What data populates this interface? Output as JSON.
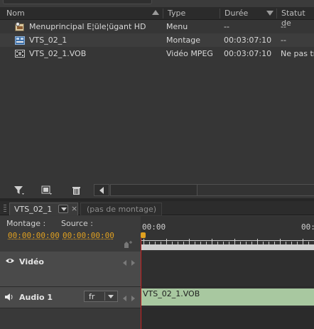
{
  "project": {
    "columns": [
      "Nom",
      "Type",
      "Durée",
      "Statut de"
    ],
    "rows": [
      {
        "icon": "menu-icon",
        "name": "Menuprincipal E¦üle¦ügant HD",
        "type": "Menu",
        "duration": "--",
        "status": "--"
      },
      {
        "icon": "sequence-icon",
        "name": "VTS_02_1",
        "type": "Montage",
        "duration": "00:03:07:10",
        "status": "--"
      },
      {
        "icon": "video-icon",
        "name": "VTS_02_1.VOB",
        "type": "Vidéo MPEG",
        "duration": "00:03:07:10",
        "status": "Ne pas tr"
      }
    ],
    "toolbar_icons": [
      "funnel-icon",
      "new-item-icon",
      "trash-icon"
    ]
  },
  "timeline": {
    "tabs": [
      {
        "label": "VTS_02_1",
        "active": true
      },
      {
        "label": "(pas de montage)",
        "active": false
      }
    ],
    "close_glyph": "×",
    "montage_label": "Montage :",
    "montage_tc": "00:00:00:00",
    "source_label": "Source :",
    "source_tc": "00:00:00:00",
    "ruler": [
      "00:00",
      "00:0"
    ],
    "tracks": [
      {
        "name": "Vidéo",
        "icon": "eye-icon"
      },
      {
        "name": "Audio 1",
        "icon": "speaker-icon",
        "language": "fr"
      }
    ],
    "clip_label": "VTS_02_1.VOB"
  },
  "colors": {
    "timecode": "#e0a020",
    "clip": "#a8c8a0",
    "playhead": "#cc2020"
  }
}
